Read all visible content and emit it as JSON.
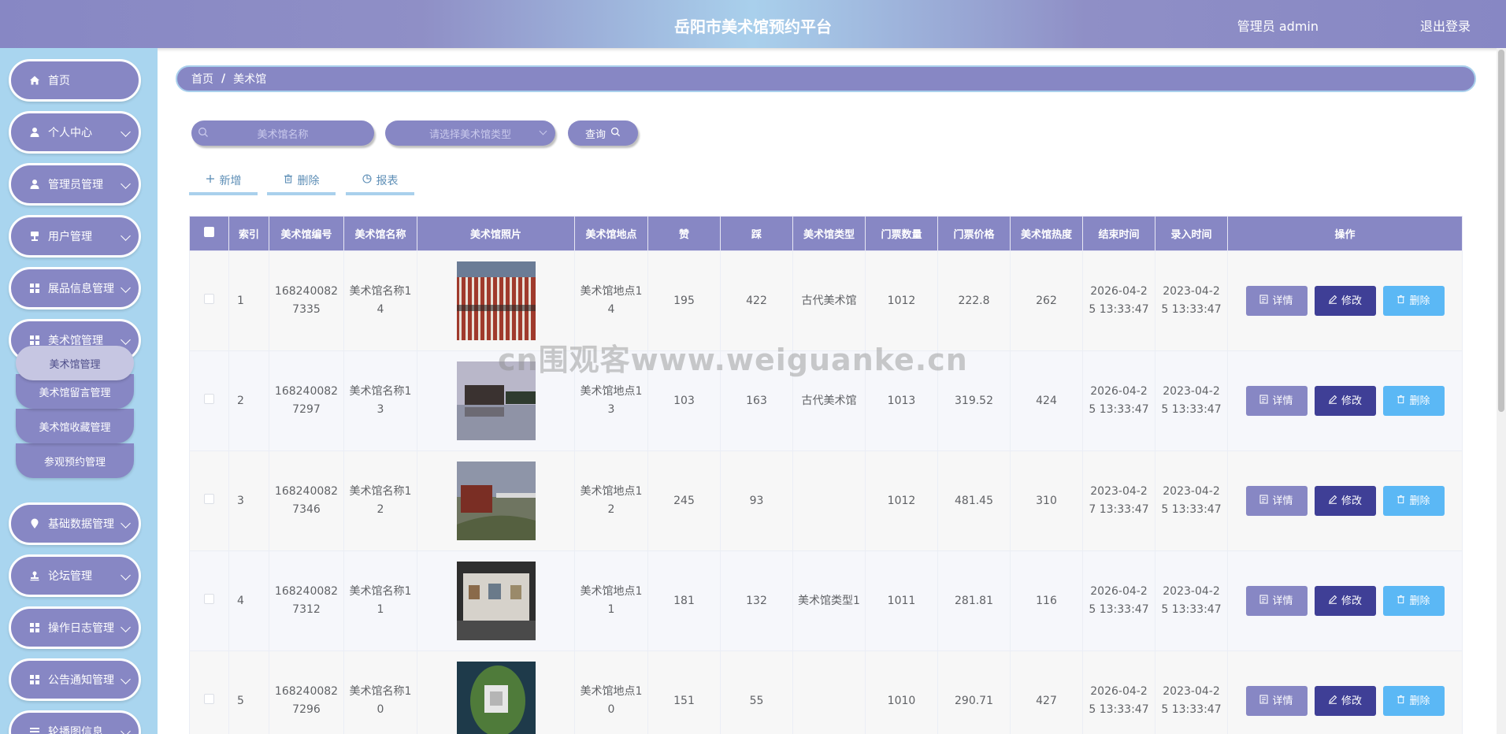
{
  "header": {
    "title": "岳阳市美术馆预约平台",
    "user": "管理员 admin",
    "logout": "退出登录"
  },
  "sidebar": {
    "items": [
      {
        "label": "首页",
        "icon": "home-icon"
      },
      {
        "label": "个人中心",
        "icon": "user-icon"
      },
      {
        "label": "管理员管理",
        "icon": "user-icon"
      },
      {
        "label": "用户管理",
        "icon": "chair-icon"
      },
      {
        "label": "展品信息管理",
        "icon": "grid-icon"
      },
      {
        "label": "美术馆管理",
        "icon": "grid-icon"
      },
      {
        "label": "基础数据管理",
        "icon": "location-pin-icon"
      },
      {
        "label": "论坛管理",
        "icon": "stamp-icon"
      },
      {
        "label": "操作日志管理",
        "icon": "grid-icon"
      },
      {
        "label": "公告通知管理",
        "icon": "grid-icon"
      },
      {
        "label": "轮播图信息",
        "icon": "list-icon"
      }
    ],
    "submenu": [
      "美术馆管理",
      "美术馆留言管理",
      "美术馆收藏管理",
      "参观预约管理"
    ]
  },
  "breadcrumb": {
    "home": "首页",
    "sep": "/",
    "current": "美术馆"
  },
  "search": {
    "name_placeholder": "美术馆名称",
    "type_placeholder": "请选择美术馆类型",
    "query": "查询"
  },
  "actions": {
    "add": "新增",
    "delete": "删除",
    "report": "报表"
  },
  "table": {
    "headers": [
      "索引",
      "美术馆编号",
      "美术馆名称",
      "美术馆照片",
      "美术馆地点",
      "赞",
      "踩",
      "美术馆类型",
      "门票数量",
      "门票价格",
      "美术馆热度",
      "结束时间",
      "录入时间",
      "操作"
    ],
    "rows": [
      {
        "index": "1",
        "code": "1682400827335",
        "name": "美术馆名称14",
        "place": "美术馆地点14",
        "like": "195",
        "dislike": "422",
        "type": "古代美术馆",
        "tickets": "1012",
        "price": "222.8",
        "heat": "262",
        "end": "2026-04-25 13:33:47",
        "created": "2023-04-25 13:33:47"
      },
      {
        "index": "2",
        "code": "1682400827297",
        "name": "美术馆名称13",
        "place": "美术馆地点13",
        "like": "103",
        "dislike": "163",
        "type": "古代美术馆",
        "tickets": "1013",
        "price": "319.52",
        "heat": "424",
        "end": "2026-04-25 13:33:47",
        "created": "2023-04-25 13:33:47"
      },
      {
        "index": "3",
        "code": "1682400827346",
        "name": "美术馆名称12",
        "place": "美术馆地点12",
        "like": "245",
        "dislike": "93",
        "type": "",
        "tickets": "1012",
        "price": "481.45",
        "heat": "310",
        "end": "2023-04-27 13:33:47",
        "created": "2023-04-25 13:33:47"
      },
      {
        "index": "4",
        "code": "1682400827312",
        "name": "美术馆名称11",
        "place": "美术馆地点11",
        "like": "181",
        "dislike": "132",
        "type": "美术馆类型1",
        "tickets": "1011",
        "price": "281.81",
        "heat": "116",
        "end": "2026-04-25 13:33:47",
        "created": "2023-04-25 13:33:47"
      },
      {
        "index": "5",
        "code": "1682400827296",
        "name": "美术馆名称10",
        "place": "美术馆地点10",
        "like": "151",
        "dislike": "55",
        "type": "",
        "tickets": "1010",
        "price": "290.71",
        "heat": "427",
        "end": "2026-04-25 13:33:47",
        "created": "2023-04-25 13:33:47"
      }
    ],
    "ops": {
      "detail": "详情",
      "edit": "修改",
      "delete": "删除"
    }
  },
  "watermark": "cn围观客www.weiguanke.cn",
  "colors": {
    "primary": "#8787c4",
    "sidebar_bg": "#a9d5ef",
    "edit": "#3f3f96",
    "delete": "#5bb8f5"
  }
}
